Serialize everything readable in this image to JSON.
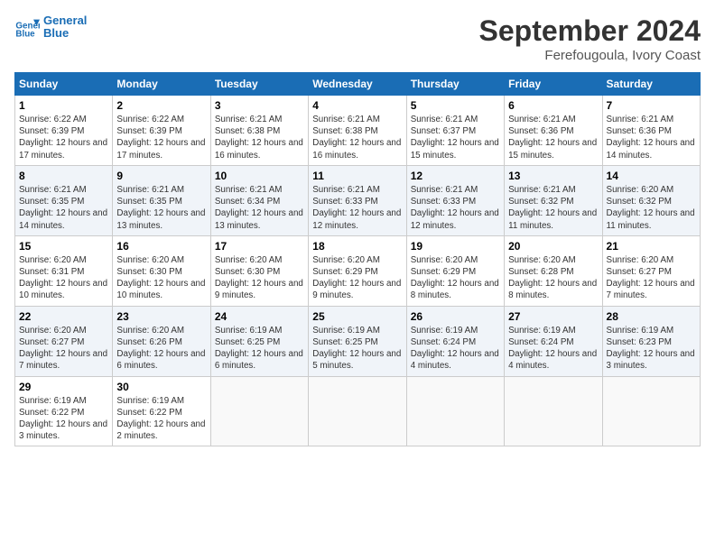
{
  "header": {
    "logo_line1": "General",
    "logo_line2": "Blue",
    "month": "September 2024",
    "location": "Ferefougoula, Ivory Coast"
  },
  "weekdays": [
    "Sunday",
    "Monday",
    "Tuesday",
    "Wednesday",
    "Thursday",
    "Friday",
    "Saturday"
  ],
  "weeks": [
    [
      {
        "day": "1",
        "sunrise": "6:22 AM",
        "sunset": "6:39 PM",
        "daylight": "12 hours and 17 minutes."
      },
      {
        "day": "2",
        "sunrise": "6:22 AM",
        "sunset": "6:39 PM",
        "daylight": "12 hours and 17 minutes."
      },
      {
        "day": "3",
        "sunrise": "6:21 AM",
        "sunset": "6:38 PM",
        "daylight": "12 hours and 16 minutes."
      },
      {
        "day": "4",
        "sunrise": "6:21 AM",
        "sunset": "6:38 PM",
        "daylight": "12 hours and 16 minutes."
      },
      {
        "day": "5",
        "sunrise": "6:21 AM",
        "sunset": "6:37 PM",
        "daylight": "12 hours and 15 minutes."
      },
      {
        "day": "6",
        "sunrise": "6:21 AM",
        "sunset": "6:36 PM",
        "daylight": "12 hours and 15 minutes."
      },
      {
        "day": "7",
        "sunrise": "6:21 AM",
        "sunset": "6:36 PM",
        "daylight": "12 hours and 14 minutes."
      }
    ],
    [
      {
        "day": "8",
        "sunrise": "6:21 AM",
        "sunset": "6:35 PM",
        "daylight": "12 hours and 14 minutes."
      },
      {
        "day": "9",
        "sunrise": "6:21 AM",
        "sunset": "6:35 PM",
        "daylight": "12 hours and 13 minutes."
      },
      {
        "day": "10",
        "sunrise": "6:21 AM",
        "sunset": "6:34 PM",
        "daylight": "12 hours and 13 minutes."
      },
      {
        "day": "11",
        "sunrise": "6:21 AM",
        "sunset": "6:33 PM",
        "daylight": "12 hours and 12 minutes."
      },
      {
        "day": "12",
        "sunrise": "6:21 AM",
        "sunset": "6:33 PM",
        "daylight": "12 hours and 12 minutes."
      },
      {
        "day": "13",
        "sunrise": "6:21 AM",
        "sunset": "6:32 PM",
        "daylight": "12 hours and 11 minutes."
      },
      {
        "day": "14",
        "sunrise": "6:20 AM",
        "sunset": "6:32 PM",
        "daylight": "12 hours and 11 minutes."
      }
    ],
    [
      {
        "day": "15",
        "sunrise": "6:20 AM",
        "sunset": "6:31 PM",
        "daylight": "12 hours and 10 minutes."
      },
      {
        "day": "16",
        "sunrise": "6:20 AM",
        "sunset": "6:30 PM",
        "daylight": "12 hours and 10 minutes."
      },
      {
        "day": "17",
        "sunrise": "6:20 AM",
        "sunset": "6:30 PM",
        "daylight": "12 hours and 9 minutes."
      },
      {
        "day": "18",
        "sunrise": "6:20 AM",
        "sunset": "6:29 PM",
        "daylight": "12 hours and 9 minutes."
      },
      {
        "day": "19",
        "sunrise": "6:20 AM",
        "sunset": "6:29 PM",
        "daylight": "12 hours and 8 minutes."
      },
      {
        "day": "20",
        "sunrise": "6:20 AM",
        "sunset": "6:28 PM",
        "daylight": "12 hours and 8 minutes."
      },
      {
        "day": "21",
        "sunrise": "6:20 AM",
        "sunset": "6:27 PM",
        "daylight": "12 hours and 7 minutes."
      }
    ],
    [
      {
        "day": "22",
        "sunrise": "6:20 AM",
        "sunset": "6:27 PM",
        "daylight": "12 hours and 7 minutes."
      },
      {
        "day": "23",
        "sunrise": "6:20 AM",
        "sunset": "6:26 PM",
        "daylight": "12 hours and 6 minutes."
      },
      {
        "day": "24",
        "sunrise": "6:19 AM",
        "sunset": "6:25 PM",
        "daylight": "12 hours and 6 minutes."
      },
      {
        "day": "25",
        "sunrise": "6:19 AM",
        "sunset": "6:25 PM",
        "daylight": "12 hours and 5 minutes."
      },
      {
        "day": "26",
        "sunrise": "6:19 AM",
        "sunset": "6:24 PM",
        "daylight": "12 hours and 4 minutes."
      },
      {
        "day": "27",
        "sunrise": "6:19 AM",
        "sunset": "6:24 PM",
        "daylight": "12 hours and 4 minutes."
      },
      {
        "day": "28",
        "sunrise": "6:19 AM",
        "sunset": "6:23 PM",
        "daylight": "12 hours and 3 minutes."
      }
    ],
    [
      {
        "day": "29",
        "sunrise": "6:19 AM",
        "sunset": "6:22 PM",
        "daylight": "12 hours and 3 minutes."
      },
      {
        "day": "30",
        "sunrise": "6:19 AM",
        "sunset": "6:22 PM",
        "daylight": "12 hours and 2 minutes."
      },
      null,
      null,
      null,
      null,
      null
    ]
  ]
}
